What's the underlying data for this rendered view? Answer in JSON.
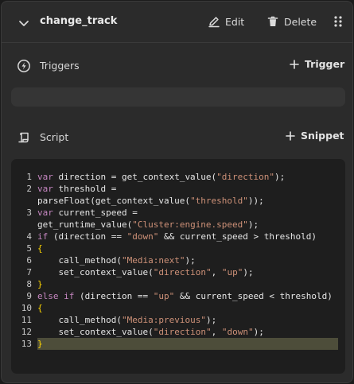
{
  "header": {
    "title": "change_track",
    "edit_label": "Edit",
    "delete_label": "Delete"
  },
  "triggers": {
    "label": "Triggers",
    "add_label": "Trigger"
  },
  "script": {
    "label": "Script",
    "add_label": "Snippet"
  },
  "code_lines": [
    {
      "n": "1",
      "parts": [
        [
          "kw",
          "var"
        ],
        [
          "plain",
          " direction = get_context_value("
        ],
        [
          "str",
          "\"direction\""
        ],
        [
          "plain",
          ");"
        ]
      ]
    },
    {
      "n": "2",
      "parts": [
        [
          "kw",
          "var"
        ],
        [
          "plain",
          " threshold = parseFloat(get_context_value("
        ],
        [
          "str",
          "\"threshold\""
        ],
        [
          "plain",
          "));"
        ]
      ]
    },
    {
      "n": "3",
      "parts": [
        [
          "kw",
          "var"
        ],
        [
          "plain",
          " current_speed = get_runtime_value("
        ],
        [
          "str",
          "\"Cluster:engine.speed\""
        ],
        [
          "plain",
          ");"
        ]
      ]
    },
    {
      "n": "4",
      "parts": [
        [
          "kw",
          "if"
        ],
        [
          "plain",
          " (direction == "
        ],
        [
          "str",
          "\"down\""
        ],
        [
          "plain",
          " && current_speed > threshold)"
        ]
      ]
    },
    {
      "n": "5",
      "parts": [
        [
          "brace",
          "{"
        ]
      ]
    },
    {
      "n": "6",
      "parts": [
        [
          "plain",
          "    call_method("
        ],
        [
          "str",
          "\"Media:next\""
        ],
        [
          "plain",
          ");"
        ]
      ]
    },
    {
      "n": "7",
      "parts": [
        [
          "plain",
          "    set_context_value("
        ],
        [
          "str",
          "\"direction\""
        ],
        [
          "plain",
          ", "
        ],
        [
          "str",
          "\"up\""
        ],
        [
          "plain",
          ");"
        ]
      ]
    },
    {
      "n": "8",
      "parts": [
        [
          "brace",
          "}"
        ]
      ]
    },
    {
      "n": "9",
      "parts": [
        [
          "kw",
          "else if"
        ],
        [
          "plain",
          " (direction == "
        ],
        [
          "str",
          "\"up\""
        ],
        [
          "plain",
          " && current_speed < threshold)"
        ]
      ]
    },
    {
      "n": "10",
      "parts": [
        [
          "brace",
          "{"
        ]
      ]
    },
    {
      "n": "11",
      "parts": [
        [
          "plain",
          "    call_method("
        ],
        [
          "str",
          "\"Media:previous\""
        ],
        [
          "plain",
          ");"
        ]
      ]
    },
    {
      "n": "12",
      "parts": [
        [
          "plain",
          "    set_context_value("
        ],
        [
          "str",
          "\"direction\""
        ],
        [
          "plain",
          ", "
        ],
        [
          "str",
          "\"down\""
        ],
        [
          "plain",
          ");"
        ]
      ]
    },
    {
      "n": "13",
      "parts": [
        [
          "brace",
          "}"
        ]
      ],
      "highlight": true
    }
  ],
  "icons": {
    "collapse": "chevron-down-icon",
    "edit": "pencil-icon",
    "delete": "trash-icon",
    "more": "drag-dots-icon",
    "triggers": "lightning-icon",
    "script": "script-icon",
    "add": "plus-icon"
  }
}
